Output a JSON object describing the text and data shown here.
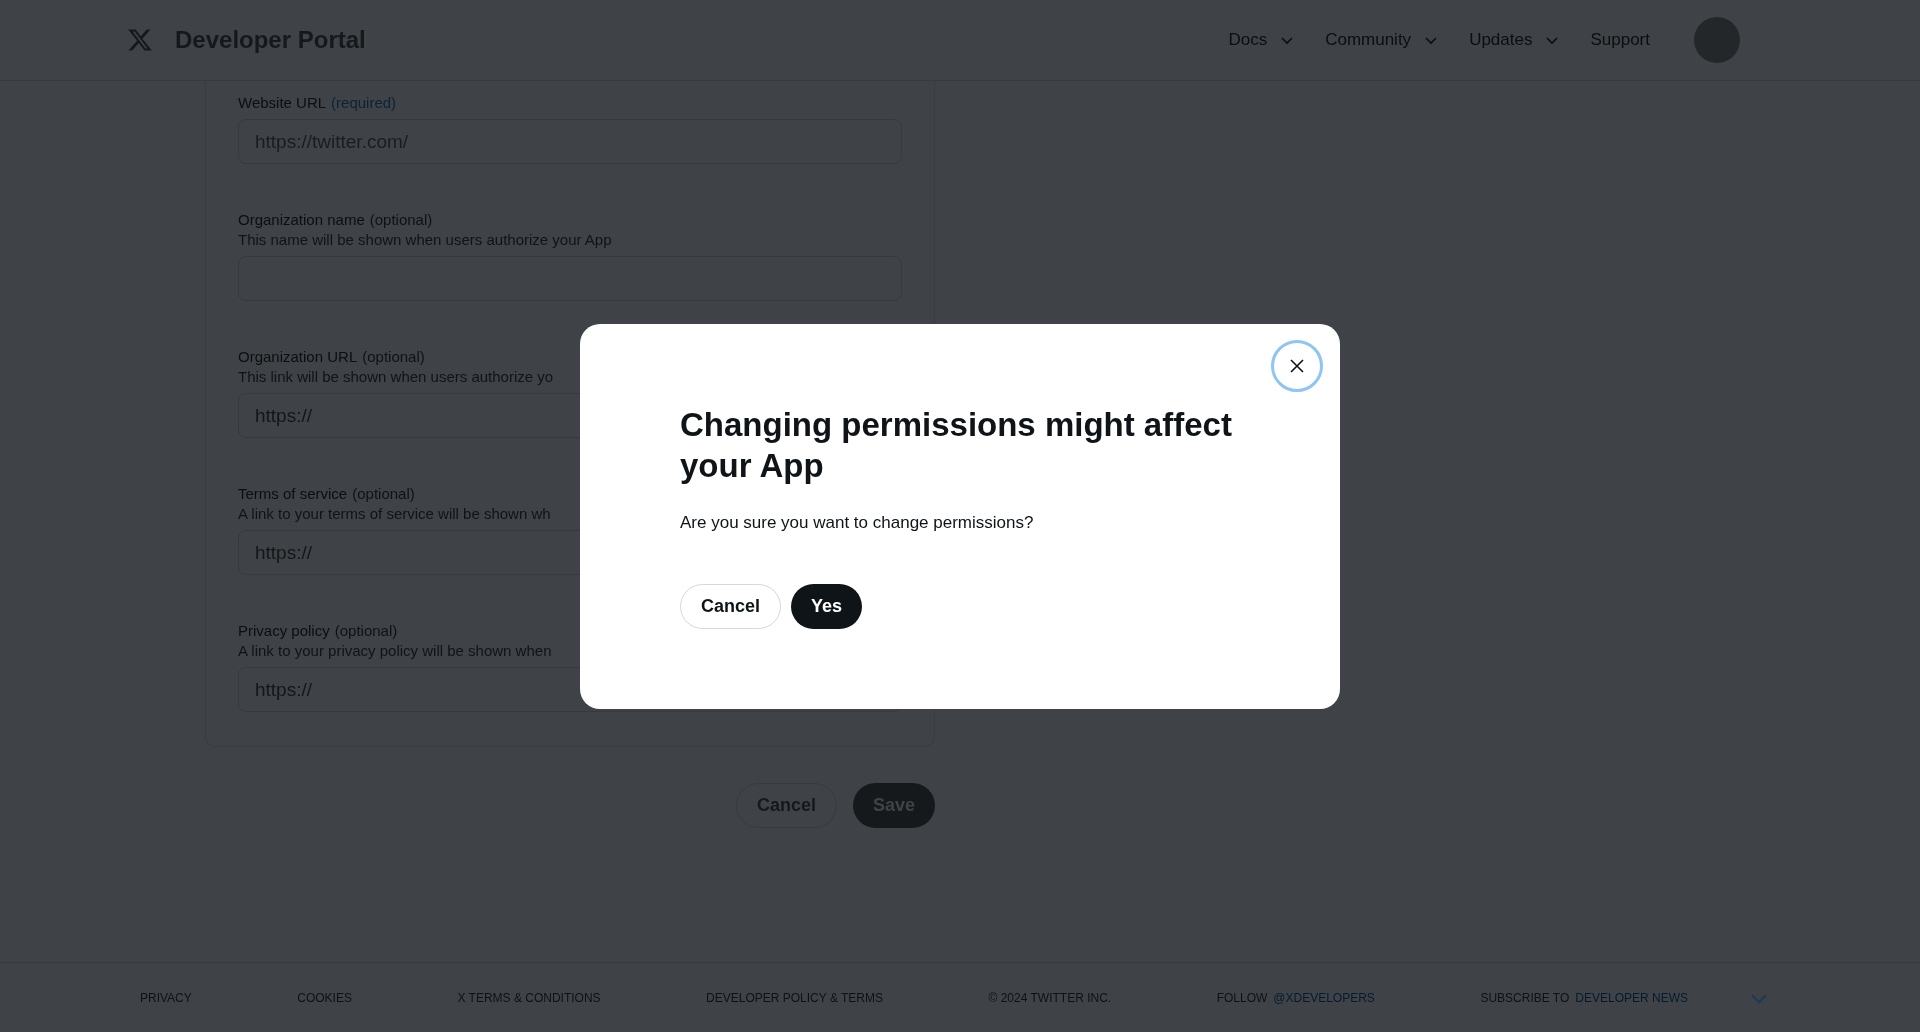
{
  "header": {
    "logo_text": "Developer Portal",
    "nav": [
      {
        "label": "Docs",
        "dropdown": true
      },
      {
        "label": "Community",
        "dropdown": true
      },
      {
        "label": "Updates",
        "dropdown": true
      },
      {
        "label": "Support",
        "dropdown": false
      }
    ]
  },
  "form": {
    "fields": [
      {
        "label": "Website URL",
        "tag": "(required)",
        "required": true,
        "value": "https://twitter.com/"
      },
      {
        "label": "Organization name",
        "tag": "(optional)",
        "required": false,
        "help": "This name will be shown when users authorize your App"
      },
      {
        "label": "Organization URL",
        "tag": "(optional)",
        "required": false,
        "help": "This link will be shown when users authorize yo",
        "placeholder": "https://"
      },
      {
        "label": "Terms of service",
        "tag": "(optional)",
        "required": false,
        "help": "A link to your terms of service will be shown wh",
        "placeholder": "https://"
      },
      {
        "label": "Privacy policy",
        "tag": "(optional)",
        "required": false,
        "help": "A link to your privacy policy will be shown when",
        "placeholder": "https://"
      }
    ],
    "actions": [
      {
        "label": "Cancel",
        "kind": "secondary"
      },
      {
        "label": "Save",
        "kind": "primary"
      }
    ]
  },
  "footer": {
    "items": [
      {
        "text": "PRIVACY"
      },
      {
        "text": "COOKIES"
      },
      {
        "text": "X TERMS & CONDITIONS"
      },
      {
        "text": "DEVELOPER POLICY & TERMS"
      },
      {
        "text": "© 2024 TWITTER INC."
      },
      {
        "text": "FOLLOW",
        "link": "@XDEVELOPERS"
      },
      {
        "text": "SUBSCRIBE TO",
        "link": "DEVELOPER NEWS"
      }
    ]
  },
  "dialog": {
    "title": "Changing permissions might affect your App",
    "message": "Are you sure you want to change permissions?",
    "buttons": [
      {
        "label": "Cancel",
        "kind": "secondary"
      },
      {
        "label": "Yes",
        "kind": "primary"
      }
    ]
  }
}
